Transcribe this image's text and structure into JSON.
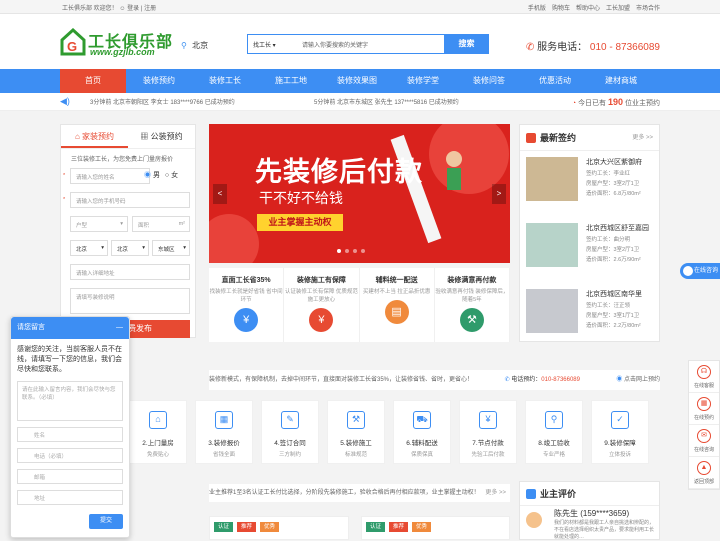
{
  "topbar": {
    "welcome": "工长俱乐部  欢迎您！",
    "login": "登录",
    "register": "注册",
    "links": [
      "手机版",
      "购物车",
      "帮助中心",
      "工长加盟",
      "市场合作"
    ]
  },
  "logo": {
    "name": "工长俱乐部",
    "domain": "www.gzjlb.com"
  },
  "city": "北京",
  "search": {
    "category": "找工长",
    "placeholder": "请输入你要搜索的关键字",
    "button": "搜索"
  },
  "hotline": {
    "label": "服务电话：",
    "number": "010 - 87366089"
  },
  "nav": [
    "首页",
    "装修预约",
    "装修工长",
    "施工工地",
    "装修效果图",
    "装修学堂",
    "装修问答",
    "优惠活动",
    "建材商城"
  ],
  "ticker": {
    "item1": "3分钟前    北京市朝阳区    李女士    183****9766    已成功预约",
    "item2": "5分钟前    北京市东城区    张先生    137****5816    已成功预约",
    "count_prefix": "今日已有",
    "count": "190",
    "count_suffix": "位业主预约"
  },
  "form": {
    "tab1": "家装预约",
    "tab2": "公装预约",
    "slogan": "三位装修工长，为您免费上门量房报价",
    "name_placeholder": "请输入您的姓名",
    "gender_male": "男",
    "gender_female": "女",
    "phone_placeholder": "请输入您的手机号码",
    "house_type": "户型",
    "area": "面积",
    "area_unit": "m²",
    "province": "北京",
    "city": "北京",
    "district": "东城区",
    "address_placeholder": "请输入详细地址",
    "desc_placeholder": "请填写装修说明",
    "submit": "免费发布"
  },
  "chat": {
    "title": "请您留言",
    "close": "—",
    "message": "感谢您的关注，当前客服人员不在线，请填写一下您的信息，我们会尽快和您联系。",
    "textarea_placeholder": "请在此输入留言内容，我们会尽快与您联系。（必填）",
    "name": "姓名",
    "phone": "电话（必填）",
    "email": "邮箱",
    "address": "地址",
    "submit": "提交"
  },
  "banner": {
    "title": "先装修后付款",
    "subtitle": "干不好不给钱",
    "badge": "业主掌握主动权",
    "prev": "<",
    "next": ">"
  },
  "features": [
    {
      "title": "直面工长省35%",
      "desc": "找装修工长就是好省钱 省中间环节"
    },
    {
      "title": "装修施工有保障",
      "desc": "认证装修工长有保障 优质规范施工更放心"
    },
    {
      "title": "辅料统一配送",
      "desc": "买建材不上当 拉正品折优惠"
    },
    {
      "title": "装修满意再付款",
      "desc": "验收满意再付钱 装修保障后，随着5年"
    }
  ],
  "latest": {
    "title": "最新签约",
    "more": "更多 >>",
    "items": [
      {
        "name": "北京大兴区紫御府",
        "foreman": "签约工长：李业红",
        "layout": "房屋户型：3室2厅1卫",
        "price": "造价面积：6.8万/80m²"
      },
      {
        "name": "北京西城区舒至嘉园",
        "foreman": "签约工长：曲分明",
        "layout": "房屋户型：3室2厅1卫",
        "price": "造价面积：2.6万/90m²"
      },
      {
        "name": "北京西城区南华里",
        "foreman": "签约工长：汪正领",
        "layout": "房屋户型：3室1厅1卫",
        "price": "造价面积：2.2万/80m²"
      }
    ]
  },
  "strip": {
    "text": "装修新模式，有保障机制，去掉中间环节，直接面对装修工长省35%，让装修省钱、省时，更省心！",
    "phone_label": "电话预约：",
    "phone": "010-87366089",
    "book": "点击网上预约"
  },
  "steps": [
    {
      "title": "2.上门量房",
      "desc": "免费贴心"
    },
    {
      "title": "3.装修报价",
      "desc": "省钱全面"
    },
    {
      "title": "4.签订合同",
      "desc": "三方制约"
    },
    {
      "title": "5.装修施工",
      "desc": "标准规范"
    },
    {
      "title": "6.辅料配送",
      "desc": "保质保真"
    },
    {
      "title": "7.节点付款",
      "desc": "先验工后付款"
    },
    {
      "title": "8.竣工验收",
      "desc": "专业严格"
    },
    {
      "title": "9.装修保障",
      "desc": "立体投诉"
    }
  ],
  "strip2": {
    "text": "业主推荐1至3名认证工长付比选择，分阶段先装修施工，验收合格后再付相应款项，业主掌握主动权！",
    "more": "更多 >>"
  },
  "cards": {
    "tags": [
      "认证",
      "推荐",
      "优秀"
    ]
  },
  "review": {
    "title": "业主评价",
    "name": "陈先生 (159****3659)",
    "text": "我们的材料都是我跟工人亲自挑选和辨配的，不在看店选择组织太贵产品，要求能利用工长就能处理的…"
  },
  "online": "在线咨询",
  "rside": [
    "在线客服",
    "在线预约",
    "在线咨询",
    "返回顶部"
  ],
  "colors": {
    "brand_blue": "#3d8ef3",
    "brand_red": "#e74a32",
    "logo_green": "#2f9b2f"
  }
}
